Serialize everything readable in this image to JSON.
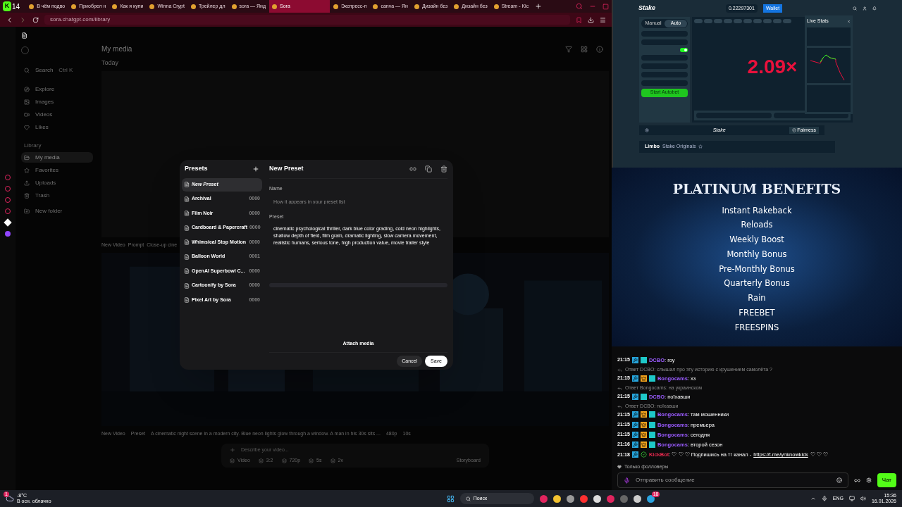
{
  "browser": {
    "logo": "K",
    "profile_badge": "14",
    "url": "sora.chatgpt.com/library",
    "tabs": [
      {
        "label": "В чём подво",
        "selected": false
      },
      {
        "label": "Приобрел н",
        "selected": false
      },
      {
        "label": "Как я купи",
        "selected": false
      },
      {
        "label": "Winna Crypt",
        "selected": false
      },
      {
        "label": "Трейлер дл",
        "selected": false
      },
      {
        "label": "sora — Янд",
        "selected": false
      },
      {
        "label": "Sora",
        "selected": true
      },
      {
        "label": "Экспресс-п",
        "selected": false
      },
      {
        "label": "canva — Ян",
        "selected": false
      },
      {
        "label": "Дизайн без",
        "selected": false
      },
      {
        "label": "Дизайн без",
        "selected": false
      },
      {
        "label": "Stream - Kic",
        "selected": false
      }
    ]
  },
  "sora": {
    "search": "Search",
    "search_shortcut": "Ctrl K",
    "nav": [
      {
        "label": "Explore",
        "selected": false
      },
      {
        "label": "Images",
        "selected": false
      },
      {
        "label": "Videos",
        "selected": false
      },
      {
        "label": "Likes",
        "selected": false
      }
    ],
    "library_heading": "Library",
    "library": [
      {
        "label": "My media",
        "selected": true
      },
      {
        "label": "Favorites",
        "selected": false
      },
      {
        "label": "Uploads",
        "selected": false
      },
      {
        "label": "Trash",
        "selected": false
      }
    ],
    "new_folder": "New folder",
    "page_title": "My media",
    "section": "Today",
    "feed": [
      {
        "title": "New Video",
        "kind": "Prompt",
        "text": "Close-up cine"
      },
      {
        "title": "New Video",
        "kind": "Preset",
        "text": "A cinematic night scene in a modern city. Blue neon lights glow through a window. A man in his 30s sits ...",
        "meta": [
          "480p",
          "10s"
        ]
      }
    ],
    "composer": {
      "placeholder": "Describe your video...",
      "chips": [
        "Video",
        "3:2",
        "720p",
        "5s",
        "2v"
      ],
      "storyboard": "Storyboard"
    }
  },
  "dialog": {
    "list_title": "Presets",
    "presets": [
      {
        "name": "New Preset",
        "selected": true
      },
      {
        "name": "Archival",
        "count": "0000",
        "selected": false
      },
      {
        "name": "Film Noir",
        "count": "0000",
        "selected": false
      },
      {
        "name": "Cardboard & Papercraft",
        "count": "0000",
        "selected": false
      },
      {
        "name": "Whimsical Stop Motion",
        "count": "0000",
        "selected": false
      },
      {
        "name": "Balloon World",
        "count": "0001",
        "selected": false
      },
      {
        "name": "OpenAI Superbowl C...",
        "count": "0000",
        "selected": false
      },
      {
        "name": "Cartoonify by Sora",
        "count": "0000",
        "selected": false
      },
      {
        "name": "Pixel Art by Sora",
        "count": "0000",
        "selected": false
      }
    ],
    "title": "New Preset",
    "name_label": "Name",
    "name_placeholder": "How it appears in your preset list",
    "preset_label": "Preset",
    "preset_value": "cinematic psychological thriller, dark blue color grading, cold neon highlights, shallow depth of field, film grain, dramatic lighting, slow camera movement, realistic humans, serious tone, high production value, movie trailer style",
    "attach": "Attach media",
    "cancel": "Cancel",
    "save": "Save"
  },
  "stake": {
    "logo": "Stake",
    "balance": "0.22297301",
    "wallet": "Wallet",
    "modes": [
      {
        "label": "Manual",
        "selected": false
      },
      {
        "label": "Auto",
        "selected": true
      }
    ],
    "advanced_on": true,
    "start": "Start Autobet",
    "multiplier": "2.09×",
    "stats_title": "Live Stats",
    "footer_logo": "Stake",
    "fairness": "Fairness",
    "game": "Limbo",
    "game_sub": "Stake Originals"
  },
  "benefits": {
    "title": "PLATINUM BENEFITS",
    "items": [
      "Instant Rakeback",
      "Reloads",
      "Weekly Boost",
      "Monthly Bonus",
      "Pre-Monthly Bonus",
      "Quarterly Bonus",
      "Rain",
      "FREEBET",
      "FREESPINS"
    ]
  },
  "chat": {
    "messages": [
      {
        "time": "21:15",
        "badges": [
          {
            "kind": "hammer"
          },
          {
            "kind": "og"
          }
        ],
        "user": "DCBO",
        "color": "#9b5cff",
        "text": ": гоу"
      },
      {
        "reply": "Ответ DCBO: слышал про эту историю с крушением самолёта ?",
        "time": "21:15",
        "badges": [
          {
            "kind": "hammer"
          },
          {
            "kind": "crown"
          },
          {
            "kind": "og"
          }
        ],
        "user": "Bongocams",
        "color": "#9b5cff",
        "text": ": хз"
      },
      {
        "reply": "Ответ Bongocams: на украинском",
        "time": "21:15",
        "badges": [
          {
            "kind": "hammer"
          },
          {
            "kind": "og"
          }
        ],
        "user": "DCBO",
        "color": "#9b5cff",
        "text": ": поїхавши"
      },
      {
        "reply": "Ответ DCBO: поїхавши",
        "time": "21:15",
        "badges": [
          {
            "kind": "hammer"
          },
          {
            "kind": "crown"
          },
          {
            "kind": "og"
          }
        ],
        "user": "Bongocams",
        "color": "#9b5cff",
        "text": ": там мошенники"
      },
      {
        "time": "21:15",
        "badges": [
          {
            "kind": "hammer"
          },
          {
            "kind": "crown"
          },
          {
            "kind": "og"
          }
        ],
        "user": "Bongocams",
        "color": "#9b5cff",
        "text": ": премьера"
      },
      {
        "time": "21:15",
        "badges": [
          {
            "kind": "hammer"
          },
          {
            "kind": "crown"
          },
          {
            "kind": "og"
          }
        ],
        "user": "Bongocams",
        "color": "#9b5cff",
        "text": ": сегодня"
      },
      {
        "time": "21:16",
        "badges": [
          {
            "kind": "hammer"
          },
          {
            "kind": "crown"
          },
          {
            "kind": "og"
          }
        ],
        "user": "Bongocams",
        "color": "#9b5cff",
        "text": ": второй сезон"
      },
      {
        "time": "21:18",
        "badges": [
          {
            "kind": "hammer"
          },
          {
            "kind": "verified"
          }
        ],
        "user": "KickBot",
        "color": "#e8294f",
        "text": ": ♡ ♡ ♡ Подпишись на тг канал - ",
        "link": "https://t.me/ynknowkick",
        "after": "♡ ♡ ♡"
      }
    ],
    "followers_only": "Только фолловеры",
    "placeholder": "Отправить сообщение",
    "send": "Чат"
  },
  "taskbar": {
    "weather_badge": "1",
    "temperature": "-8°C",
    "weather": "В осн. облачно",
    "search": "Поиск",
    "lang": "ENG",
    "time": "15:36",
    "date": "16.01.2026",
    "telegram_badge": "18"
  }
}
